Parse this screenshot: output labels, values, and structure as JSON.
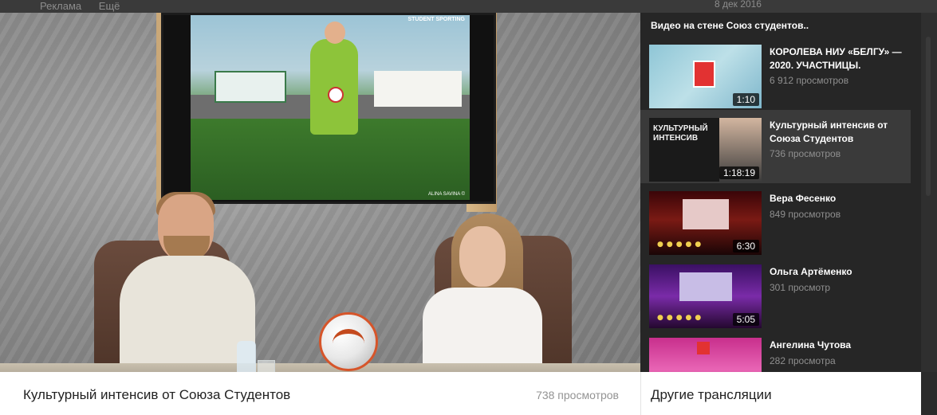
{
  "background_page": {
    "menu_items": [
      "Реклама",
      "Ещё"
    ],
    "date": "8 дек 2016"
  },
  "video": {
    "title": "Культурный интенсив от Союза Студентов",
    "views": "738 просмотров",
    "tv_logo": "STUDENT SPORTING",
    "tv_caption": "ALINA SAVINA ©"
  },
  "panel": {
    "header": "Видео на стене Союз студентов..",
    "items": [
      {
        "title": "КОРОЛЕВА НИУ «БЕЛГУ» — 2020. УЧАСТНИЦЫ.",
        "views": "6 912 просмотров",
        "duration": "1:10"
      },
      {
        "title": "Культурный интенсив от Союза Студентов",
        "views": "736 просмотров",
        "duration": "1:18:19",
        "thumb_text": "КУЛЬТУРНЫЙ ИНТЕНСИВ"
      },
      {
        "title": "Вера Фесенко",
        "views": "849 просмотров",
        "duration": "6:30"
      },
      {
        "title": "Ольга Артёменко",
        "views": "301 просмотр",
        "duration": "5:05"
      },
      {
        "title": "Ангелина Чутова",
        "views": "282 просмотра",
        "duration": ""
      }
    ],
    "other_label": "Другие трансляции"
  }
}
